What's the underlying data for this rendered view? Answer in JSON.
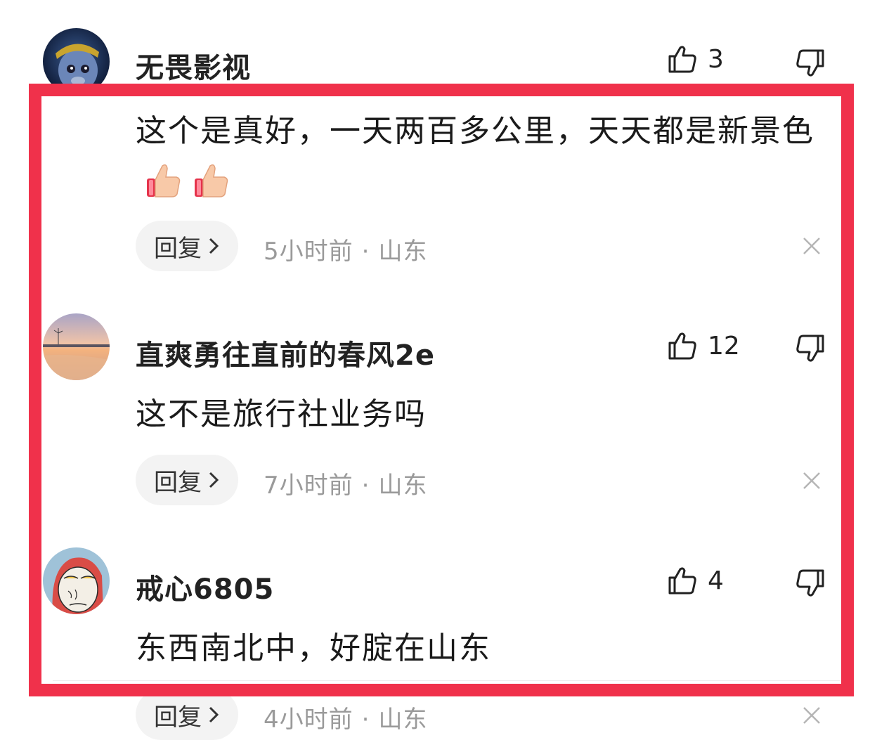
{
  "comments": [
    {
      "username": "无畏影视",
      "likes": "3",
      "content": "这个是真好，一天两百多公里，天天都是新景色",
      "reply_label": "回复",
      "time": "5小时前",
      "separator": "·",
      "location": "山东",
      "avatar_icon": "monkey-king-avatar",
      "content_emoji": [
        "thumbs-up-emoji",
        "thumbs-up-emoji"
      ]
    },
    {
      "username": "直爽勇往直前的春风2e",
      "likes": "12",
      "content": "这不是旅行社业务吗",
      "reply_label": "回复",
      "time": "7小时前",
      "separator": "·",
      "location": "山东",
      "avatar_icon": "sunset-beach-avatar"
    },
    {
      "username": "戒心6805",
      "likes": "4",
      "content": "东西南北中，好腚在山东",
      "reply_label": "回复",
      "time": "4小时前",
      "separator": "·",
      "location": "山东",
      "avatar_icon": "cartoon-face-avatar"
    }
  ],
  "colors": {
    "highlight_border": "#f0314b",
    "reply_bg": "#f3f3f3",
    "meta_text": "#9a9a9a"
  }
}
